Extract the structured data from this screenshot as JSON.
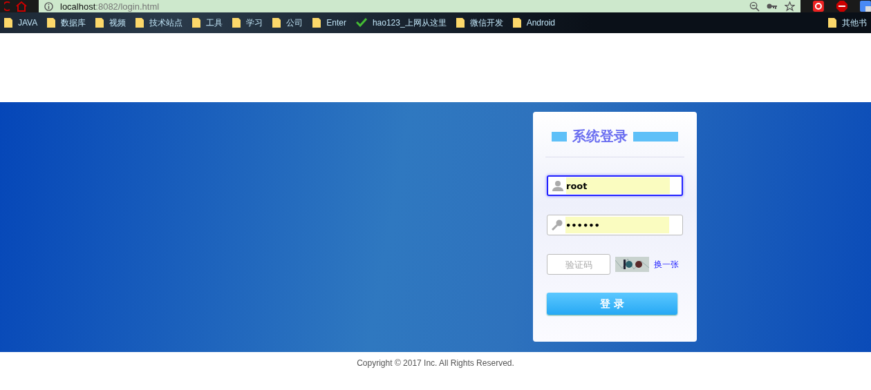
{
  "browser": {
    "address": {
      "host": "localhost",
      "rest": ":8082/login.html"
    },
    "bookmarks": [
      {
        "kind": "folder",
        "label": "JAVA"
      },
      {
        "kind": "folder",
        "label": "数据库"
      },
      {
        "kind": "folder",
        "label": "视频"
      },
      {
        "kind": "folder",
        "label": "技术站点"
      },
      {
        "kind": "folder",
        "label": "工具"
      },
      {
        "kind": "folder",
        "label": "学习"
      },
      {
        "kind": "folder",
        "label": "公司"
      },
      {
        "kind": "folder",
        "label": "Enter"
      },
      {
        "kind": "site",
        "label": "hao123_上网从这里"
      },
      {
        "kind": "folder",
        "label": "微信开发"
      },
      {
        "kind": "folder",
        "label": "Android"
      }
    ],
    "other_bookmarks": "其他书"
  },
  "login": {
    "title": "系统登录",
    "username": {
      "value": "root",
      "focused": true
    },
    "password": {
      "value": "••••••",
      "focused": false
    },
    "captcha": {
      "placeholder": "验证码",
      "refresh_link": "换一张"
    },
    "submit": "登 录"
  },
  "footer": "Copyright © 2017 Inc. All Rights Reserved."
}
